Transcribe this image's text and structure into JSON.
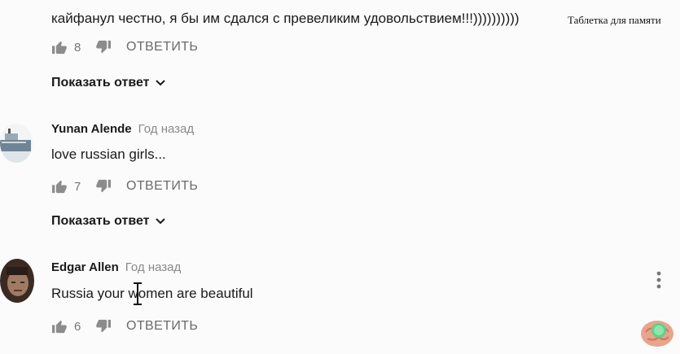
{
  "watermark": {
    "text": "Таблетка для памяти"
  },
  "comments": [
    {
      "text": "кайфанул честно, я бы им сдался с превеликим удовольствием!!!))))))))))",
      "likes": "8",
      "reply_label": "ОТВЕТИТЬ",
      "show_replies": "Показать ответ"
    },
    {
      "author": "Yunan Alende",
      "time": "Год назад",
      "text": "love russian girls...",
      "likes": "7",
      "reply_label": "ОТВЕТИТЬ",
      "show_replies": "Показать ответ"
    },
    {
      "author": "Edgar Allen",
      "time": "Год назад",
      "text": "Russia your women are beautiful",
      "likes": "6",
      "reply_label": "ОТВЕТИТЬ"
    }
  ],
  "icons": {
    "like": "thumbs-up-icon",
    "dislike": "thumbs-down-icon",
    "chevron": "chevron-down-icon",
    "menu": "more-vert-icon",
    "cursor": "text-cursor-icon",
    "logo": "brain-logo-icon"
  },
  "colors": {
    "text": "#1a1a1a",
    "meta": "#8a8a8a",
    "icon": "#8c8c8c"
  }
}
